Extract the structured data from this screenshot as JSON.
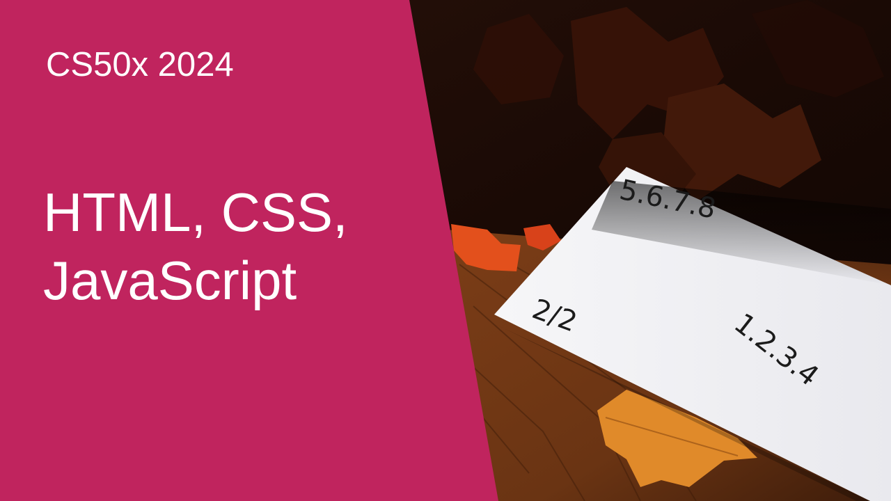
{
  "thumbnail": {
    "course": "CS50x 2024",
    "title_lines": [
      "HTML, CSS,",
      "JavaScript"
    ],
    "paper_notes": {
      "top": "5.6.7.8",
      "left": "2/2",
      "right": "1.2.3.4"
    },
    "colors": {
      "panel": "#c0245e",
      "text": "#ffffff",
      "table_wood": "#7a3f1a",
      "leaves": "#e0551e",
      "paper": "#f3f3f5"
    }
  }
}
